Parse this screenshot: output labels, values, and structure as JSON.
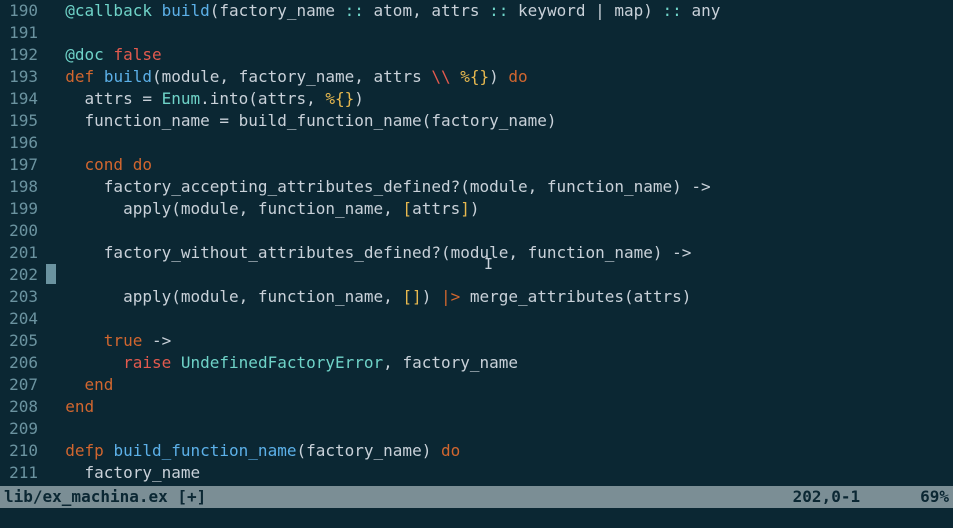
{
  "statusbar": {
    "file": "lib/ex_machina.ex [+]",
    "position": "202,0-1",
    "percent": "69%"
  },
  "gutter": [
    "190",
    "191",
    "192",
    "193",
    "194",
    "195",
    "196",
    "197",
    "198",
    "199",
    "200",
    "201",
    "202",
    "203",
    "204",
    "205",
    "206",
    "207",
    "208",
    "209",
    "210",
    "211"
  ],
  "code_lines": [
    [
      {
        "c": "tk-attr",
        "t": "  @callback"
      },
      {
        "c": "tk-op",
        "t": " "
      },
      {
        "c": "tk-fn",
        "t": "build"
      },
      {
        "c": "tk-paren",
        "t": "(factory_name "
      },
      {
        "c": "tk-colon",
        "t": "::"
      },
      {
        "c": "tk-paren",
        "t": " atom, attrs "
      },
      {
        "c": "tk-colon",
        "t": "::"
      },
      {
        "c": "tk-paren",
        "t": " keyword "
      },
      {
        "c": "tk-op",
        "t": "|"
      },
      {
        "c": "tk-paren",
        "t": " map) "
      },
      {
        "c": "tk-colon",
        "t": "::"
      },
      {
        "c": "tk-paren",
        "t": " any"
      }
    ],
    [],
    [
      {
        "c": "tk-attr",
        "t": "  @doc "
      },
      {
        "c": "tk-bool",
        "t": "false"
      }
    ],
    [
      {
        "c": "tk-op",
        "t": "  "
      },
      {
        "c": "tk-kw",
        "t": "def"
      },
      {
        "c": "tk-op",
        "t": " "
      },
      {
        "c": "tk-fn",
        "t": "build"
      },
      {
        "c": "tk-paren",
        "t": "(module, factory_name, attrs "
      },
      {
        "c": "tk-kw-red",
        "t": "\\\\"
      },
      {
        "c": "tk-paren",
        "t": " "
      },
      {
        "c": "tk-lit",
        "t": "%{}"
      },
      {
        "c": "tk-paren",
        "t": ") "
      },
      {
        "c": "tk-kw",
        "t": "do"
      }
    ],
    [
      {
        "c": "tk-op",
        "t": "    attrs = "
      },
      {
        "c": "tk-const",
        "t": "Enum"
      },
      {
        "c": "tk-op",
        "t": ".into(attrs, "
      },
      {
        "c": "tk-lit",
        "t": "%{}"
      },
      {
        "c": "tk-op",
        "t": ")"
      }
    ],
    [
      {
        "c": "tk-op",
        "t": "    function_name = build_function_name(factory_name)"
      }
    ],
    [],
    [
      {
        "c": "tk-op",
        "t": "    "
      },
      {
        "c": "tk-kw",
        "t": "cond"
      },
      {
        "c": "tk-op",
        "t": " "
      },
      {
        "c": "tk-kw",
        "t": "do"
      }
    ],
    [
      {
        "c": "tk-op",
        "t": "      factory_accepting_attributes_defined?(module, function_name) ->"
      }
    ],
    [
      {
        "c": "tk-op",
        "t": "        apply(module, function_name, "
      },
      {
        "c": "tk-lit",
        "t": "["
      },
      {
        "c": "tk-op",
        "t": "attrs"
      },
      {
        "c": "tk-lit",
        "t": "]"
      },
      {
        "c": "tk-op",
        "t": ")"
      }
    ],
    [],
    [
      {
        "c": "tk-op",
        "t": "      factory_without_attributes_defined?(module, function_name) ->"
      }
    ],
    [
      {
        "cursor": true
      }
    ],
    [
      {
        "c": "tk-op",
        "t": "        apply(module, function_name, "
      },
      {
        "c": "tk-lit",
        "t": "[]"
      },
      {
        "c": "tk-op",
        "t": ") "
      },
      {
        "c": "tk-pipe",
        "t": "|>"
      },
      {
        "c": "tk-op",
        "t": " merge_attributes(attrs)"
      }
    ],
    [],
    [
      {
        "c": "tk-op",
        "t": "      "
      },
      {
        "c": "tk-kw",
        "t": "true"
      },
      {
        "c": "tk-op",
        "t": " ->"
      }
    ],
    [
      {
        "c": "tk-op",
        "t": "        "
      },
      {
        "c": "tk-kw-red",
        "t": "raise"
      },
      {
        "c": "tk-op",
        "t": " "
      },
      {
        "c": "tk-const",
        "t": "UndefinedFactoryError"
      },
      {
        "c": "tk-op",
        "t": ", factory_name"
      }
    ],
    [
      {
        "c": "tk-op",
        "t": "    "
      },
      {
        "c": "tk-kw",
        "t": "end"
      }
    ],
    [
      {
        "c": "tk-op",
        "t": "  "
      },
      {
        "c": "tk-kw",
        "t": "end"
      }
    ],
    [],
    [
      {
        "c": "tk-op",
        "t": "  "
      },
      {
        "c": "tk-kw",
        "t": "defp"
      },
      {
        "c": "tk-op",
        "t": " "
      },
      {
        "c": "tk-fn",
        "t": "build_function_name"
      },
      {
        "c": "tk-paren",
        "t": "(factory_name) "
      },
      {
        "c": "tk-kw",
        "t": "do"
      }
    ],
    [
      {
        "c": "tk-op",
        "t": "    factory_name"
      }
    ]
  ]
}
